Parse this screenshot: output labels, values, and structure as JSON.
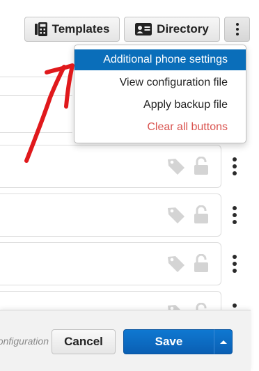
{
  "toolbar": {
    "templates_label": "Templates",
    "templates_icon": "calculator-icon",
    "directory_label": "Directory",
    "directory_icon": "contact-card-icon",
    "more_icon": "kebab-menu-icon"
  },
  "dropdown": {
    "items": [
      {
        "label": "Additional phone settings",
        "state": "highlighted"
      },
      {
        "label": "View configuration file",
        "state": "normal"
      },
      {
        "label": "Apply backup file",
        "state": "normal"
      },
      {
        "label": "Clear all buttons",
        "state": "danger"
      }
    ]
  },
  "rows": [
    {
      "icons": [
        "tag-icon",
        "unlock-icon"
      ],
      "menu_icon": "kebab-menu-icon"
    },
    {
      "icons": [
        "tag-icon",
        "unlock-icon"
      ],
      "menu_icon": "kebab-menu-icon"
    },
    {
      "icons": [
        "tag-icon",
        "unlock-icon"
      ],
      "menu_icon": "kebab-menu-icon"
    },
    {
      "icons": [
        "tag-icon",
        "unlock-icon"
      ],
      "menu_icon": "kebab-menu-icon"
    }
  ],
  "footer": {
    "hint_text": "configuration",
    "cancel_label": "Cancel",
    "save_label": "Save",
    "save_menu_icon": "caret-up-icon"
  },
  "colors": {
    "primary": "#0a6eba",
    "danger": "#d9534f",
    "annotation": "#e0191c"
  }
}
